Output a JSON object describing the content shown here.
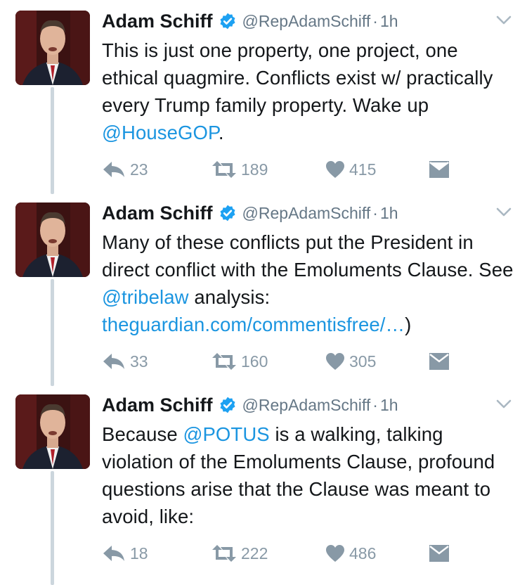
{
  "tweets": [
    {
      "name": "Adam Schiff",
      "handle": "@RepAdamSchiff",
      "sep": "·",
      "time": "1h",
      "parts": [
        {
          "t": "This is just one property, one project, one ethical quagmire. Conflicts exist w/ practically every Trump family property. Wake up ",
          "link": false
        },
        {
          "t": "@HouseGOP",
          "link": true
        },
        {
          "t": ".",
          "link": false
        }
      ],
      "replies": "23",
      "retweets": "189",
      "likes": "415"
    },
    {
      "name": "Adam Schiff",
      "handle": "@RepAdamSchiff",
      "sep": "·",
      "time": "1h",
      "parts": [
        {
          "t": "Many of these conflicts put the President in direct conflict with the Emoluments Clause. See ",
          "link": false
        },
        {
          "t": "@tribelaw",
          "link": true
        },
        {
          "t": " analysis: ",
          "link": false
        },
        {
          "t": "theguardian.com/commentisfree/…",
          "link": true
        },
        {
          "t": ")",
          "link": false
        }
      ],
      "replies": "33",
      "retweets": "160",
      "likes": "305"
    },
    {
      "name": "Adam Schiff",
      "handle": "@RepAdamSchiff",
      "sep": "·",
      "time": "1h",
      "parts": [
        {
          "t": "Because ",
          "link": false
        },
        {
          "t": "@POTUS",
          "link": true
        },
        {
          "t": " is a walking, talking violation of the Emoluments Clause, profound questions arise that the Clause was meant to avoid, like:",
          "link": false
        }
      ],
      "replies": "18",
      "retweets": "222",
      "likes": "486"
    }
  ],
  "colors": {
    "link": "#1b95e0",
    "verified": "#1da1f2",
    "icon_gray": "#8899a6",
    "thread_line": "#ccd6dd"
  },
  "icons": [
    "verified-badge-icon",
    "chevron-down-icon",
    "reply-icon",
    "retweet-icon",
    "heart-icon",
    "envelope-icon"
  ]
}
